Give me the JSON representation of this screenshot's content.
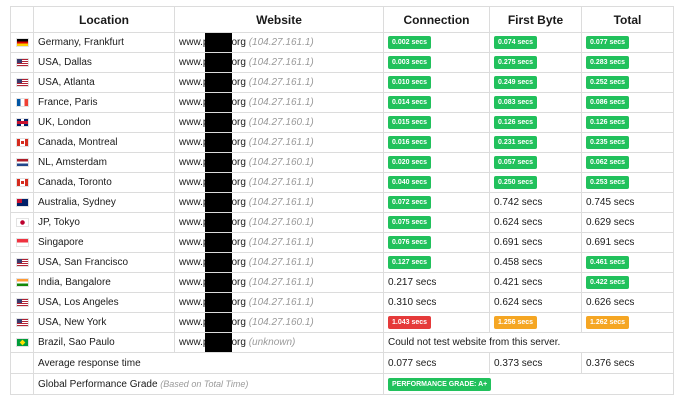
{
  "headers": {
    "location": "Location",
    "website": "Website",
    "connection": "Connection",
    "first_byte": "First Byte",
    "total": "Total"
  },
  "colors": {
    "fast": "#21c15c",
    "slow": "#e53a3a",
    "medium": "#f5a623"
  },
  "rows": [
    {
      "flag": "de",
      "location": "Germany, Frankfurt",
      "site_prefix": "www.p",
      "site_suffix": "org",
      "ip": "(104.27.161.1)",
      "connection": "0.002 secs",
      "first_byte": "0.074 secs",
      "total": "0.077 secs"
    },
    {
      "flag": "us",
      "location": "USA, Dallas",
      "site_prefix": "www.p",
      "site_suffix": "org",
      "ip": "(104.27.161.1)",
      "connection": "0.003 secs",
      "first_byte": "0.275 secs",
      "total": "0.283 secs"
    },
    {
      "flag": "us",
      "location": "USA, Atlanta",
      "site_prefix": "www.p",
      "site_suffix": "org",
      "ip": "(104.27.161.1)",
      "connection": "0.010 secs",
      "first_byte": "0.249 secs",
      "total": "0.252 secs"
    },
    {
      "flag": "fr",
      "location": "France, Paris",
      "site_prefix": "www.p",
      "site_suffix": "org",
      "ip": "(104.27.161.1)",
      "connection": "0.014 secs",
      "first_byte": "0.083 secs",
      "total": "0.086 secs"
    },
    {
      "flag": "uk",
      "location": "UK, London",
      "site_prefix": "www.p",
      "site_suffix": "org",
      "ip": "(104.27.160.1)",
      "connection": "0.015 secs",
      "first_byte": "0.126 secs",
      "total": "0.126 secs"
    },
    {
      "flag": "ca",
      "location": "Canada, Montreal",
      "site_prefix": "www.p",
      "site_suffix": "org",
      "ip": "(104.27.161.1)",
      "connection": "0.016 secs",
      "first_byte": "0.231 secs",
      "total": "0.235 secs"
    },
    {
      "flag": "nl",
      "location": "NL, Amsterdam",
      "site_prefix": "www.p",
      "site_suffix": "org",
      "ip": "(104.27.160.1)",
      "connection": "0.020 secs",
      "first_byte": "0.057 secs",
      "total": "0.062 secs"
    },
    {
      "flag": "ca",
      "location": "Canada, Toronto",
      "site_prefix": "www.p",
      "site_suffix": "org",
      "ip": "(104.27.161.1)",
      "connection": "0.040 secs",
      "first_byte": "0.250 secs",
      "total": "0.253 secs"
    },
    {
      "flag": "au",
      "location": "Australia, Sydney",
      "site_prefix": "www.p",
      "site_suffix": "org",
      "ip": "(104.27.161.1)",
      "connection": "0.072 secs",
      "first_byte": "0.742 secs",
      "total": "0.745 secs"
    },
    {
      "flag": "jp",
      "location": "JP, Tokyo",
      "site_prefix": "www.p",
      "site_suffix": "org",
      "ip": "(104.27.160.1)",
      "connection": "0.075 secs",
      "first_byte": "0.624 secs",
      "total": "0.629 secs"
    },
    {
      "flag": "sg",
      "location": "Singapore",
      "site_prefix": "www.p",
      "site_suffix": "org",
      "ip": "(104.27.161.1)",
      "connection": "0.076 secs",
      "first_byte": "0.691 secs",
      "total": "0.691 secs"
    },
    {
      "flag": "us",
      "location": "USA, San Francisco",
      "site_prefix": "www.p",
      "site_suffix": "org",
      "ip": "(104.27.161.1)",
      "connection": "0.127 secs",
      "first_byte": "0.458 secs",
      "total": "0.461 secs"
    },
    {
      "flag": "in",
      "location": "India, Bangalore",
      "site_prefix": "www.p",
      "site_suffix": "org",
      "ip": "(104.27.161.1)",
      "connection": "0.217 secs",
      "first_byte": "0.421 secs",
      "total": "0.422 secs"
    },
    {
      "flag": "us",
      "location": "USA, Los Angeles",
      "site_prefix": "www.p",
      "site_suffix": "org",
      "ip": "(104.27.161.1)",
      "connection": "0.310 secs",
      "first_byte": "0.624 secs",
      "total": "0.626 secs"
    },
    {
      "flag": "us",
      "location": "USA, New York",
      "site_prefix": "www.p",
      "site_suffix": "org",
      "ip": "(104.27.160.1)",
      "connection": "1.043 secs",
      "first_byte": "1.256 secs",
      "total": "1.262 secs"
    },
    {
      "flag": "br",
      "location": "Brazil, Sao Paulo",
      "site_prefix": "www.p",
      "site_suffix": "org",
      "ip": "(unknown)",
      "error": "Could not test website from this server."
    }
  ],
  "average": {
    "label": "Average response time",
    "connection": "0.077 secs",
    "first_byte": "0.373 secs",
    "total": "0.376 secs"
  },
  "grade": {
    "label": "Global Performance Grade",
    "note": "(Based on Total Time)",
    "badge": "PERFORMANCE GRADE: A+"
  }
}
